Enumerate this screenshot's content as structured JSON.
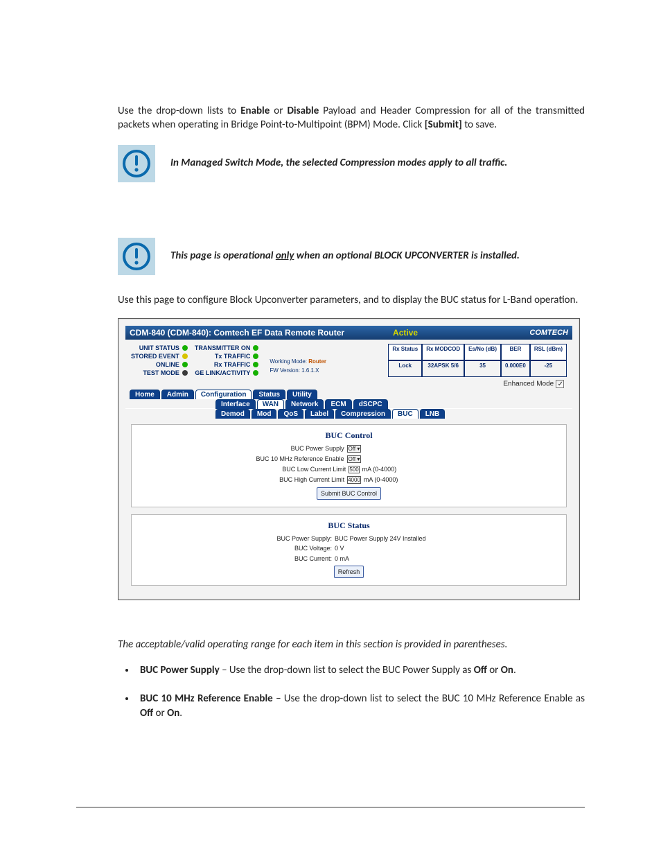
{
  "doc": {
    "intro1_pre": "Use the drop-down lists to ",
    "intro1_enable": "Enable",
    "intro1_or": " or ",
    "intro1_disable": "Disable",
    "intro1_mid": " Payload and Header Compression for all of the transmitted packets when operating in Bridge Point-to-Multipoint (BPM) Mode. Click ",
    "intro1_submit": "[Submit]",
    "intro1_end": " to save.",
    "note1": "In Managed Switch Mode, the selected Compression modes apply to all traffic.",
    "note2_pre": "This page is operational ",
    "note2_only": "only",
    "note2_post": " when an optional BLOCK UPCONVERTER is installed.",
    "intro2": "Use this page to configure Block Upconverter parameters, and to display the BUC status for L-Band operation.",
    "range_note": "The acceptable/valid operating range for each item in this section is provided in parentheses.",
    "bullets": {
      "b1_t": "BUC Power Supply",
      "b1_mid": " – Use the drop-down list to select the BUC Power Supply as ",
      "b1_off": "Off",
      "b1_or": " or ",
      "b1_on": "On",
      "b1_end": ".",
      "b2_t": "BUC 10 MHz Reference Enable",
      "b2_mid": " – Use the drop-down list to select the BUC 10 MHz Reference Enable as ",
      "b2_off": "Off",
      "b2_or": " or ",
      "b2_on": "On",
      "b2_end": "."
    }
  },
  "ui": {
    "title": "CDM-840 (CDM-840): Comtech EF Data Remote Router",
    "active": "Active",
    "logo": "COMTECH",
    "leds_left": [
      {
        "label": "UNIT STATUS",
        "color": "green"
      },
      {
        "label": "STORED EVENT",
        "color": "yellow"
      },
      {
        "label": "ONLINE",
        "color": "green"
      },
      {
        "label": "TEST MODE",
        "color": "dark"
      }
    ],
    "leds_mid": [
      {
        "label": "TRANSMITTER ON",
        "color": "green"
      },
      {
        "label": "Tx TRAFFIC",
        "color": "green"
      },
      {
        "label": "Rx TRAFFIC",
        "color": "green"
      },
      {
        "label": "GE LINK/ACTIVITY",
        "color": "green"
      }
    ],
    "meta": {
      "wm_label": "Working Mode:",
      "wm_value": "Router",
      "fw": "FW Version: 1.6.1.X"
    },
    "rx": {
      "headers": [
        "Rx Status",
        "Rx MODCOD",
        "Es/No (dB)",
        "BER",
        "RSL (dBm)"
      ],
      "values": [
        "Lock",
        "32APSK 5/6",
        "35",
        "0.000E0",
        "-25"
      ]
    },
    "enhanced": "Enhanced Mode",
    "tabs1": [
      "Home",
      "Admin",
      "Configuration",
      "Status",
      "Utility"
    ],
    "tabs1_sel": 2,
    "tabs2": [
      "Interface",
      "WAN",
      "Network",
      "ECM",
      "dSCPC"
    ],
    "tabs2_sel": 1,
    "tabs3": [
      "Demod",
      "Mod",
      "QoS",
      "Label",
      "Compression",
      "BUC",
      "LNB"
    ],
    "tabs3_sel": 5,
    "control": {
      "title": "BUC Control",
      "rows": [
        {
          "label": "BUC Power Supply",
          "type": "select",
          "value": "Off",
          "hint": ""
        },
        {
          "label": "BUC 10 MHz Reference Enable",
          "type": "select",
          "value": "Off",
          "hint": ""
        },
        {
          "label": "BUC Low Current Limit",
          "type": "input",
          "value": "500",
          "hint": "mA (0-4000)"
        },
        {
          "label": "BUC High Current Limit",
          "type": "input",
          "value": "4000",
          "hint": "mA (0-4000)"
        }
      ],
      "submit": "Submit BUC Control"
    },
    "status": {
      "title": "BUC Status",
      "rows": [
        {
          "label": "BUC Power Supply:",
          "value": "BUC Power Supply 24V Installed"
        },
        {
          "label": "BUC Voltage:",
          "value": "0 V"
        },
        {
          "label": "BUC Current:",
          "value": "0 mA"
        }
      ],
      "refresh": "Refresh"
    }
  }
}
